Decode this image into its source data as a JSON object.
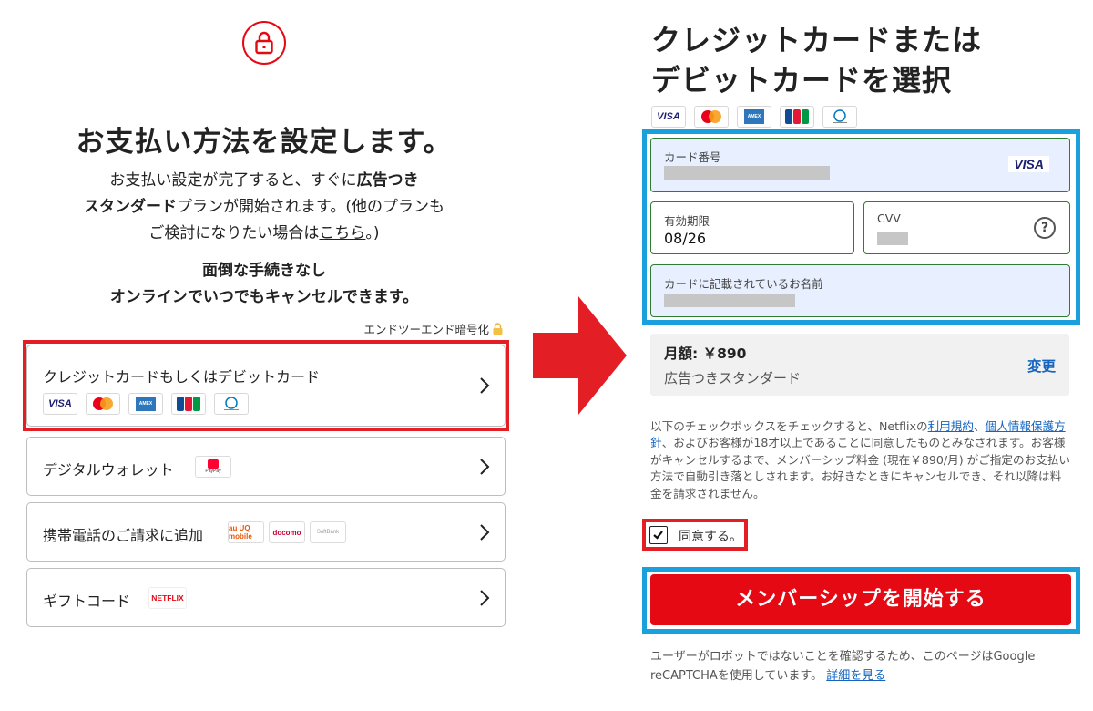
{
  "left": {
    "title": "お支払い方法を設定します。",
    "desc_line1": "お支払い設定が完了すると、すぐに",
    "desc_plan": "広告つき",
    "desc_line2_plan": "スタンダード",
    "desc_line2": "プランが開始されます。(他のプランも",
    "desc_line3": "ご検討になりたい場合は",
    "desc_link": "こちら",
    "desc_line3_end": "。)",
    "note_line1": "面倒な手続きなし",
    "note_line2": "オンラインでいつでもキャンセルできます。",
    "e2e_label": "エンドツーエンド暗号化",
    "options": [
      {
        "label": "クレジットカードもしくはデビットカード"
      },
      {
        "label": "デジタルウォレット",
        "logo": "PayPay"
      },
      {
        "label": "携帯電話のご請求に追加",
        "logos": [
          "au UQ mobile",
          "docomo",
          "SoftBank"
        ]
      },
      {
        "label": "ギフトコード",
        "logo": "NETFLIX"
      }
    ],
    "card_brands": [
      "VISA",
      "Mastercard",
      "AMEX",
      "JCB",
      "Diners Club"
    ]
  },
  "right": {
    "title_line1": "クレジットカードまたは",
    "title_line2": "デビットカードを選択",
    "card_brands": [
      "VISA",
      "Mastercard",
      "AMEX",
      "JCB",
      "Diners Club"
    ],
    "card_number_label": "カード番号",
    "card_brand_badge": "VISA",
    "expiry_label": "有効期限",
    "expiry_value": "08/26",
    "cvv_label": "CVV",
    "cvv_help": "?",
    "name_label": "カードに記載されているお名前",
    "plan_price": "月額: ￥890",
    "plan_name": "広告つきスタンダード",
    "plan_change": "変更",
    "terms_part1": "以下のチェックボックスをチェックすると、Netflixの",
    "terms_link1": "利用規約",
    "terms_sep": "、",
    "terms_link2": "個人情報保護方針",
    "terms_part2": "、およびお客様が18才以上であることに同意したものとみなされます。お客様がキャンセルするまで、メンバーシップ料金 (現在￥890/月) がご指定のお支払い方法で自動引き落としされます。お好きなときにキャンセルでき、それ以降は料金を請求されません。",
    "agree_label": "同意する。",
    "start_button": "メンバーシップを開始する",
    "captcha_text": "ユーザーがロボットではないことを確認するため、このページはGoogle reCAPTCHAを使用しています。",
    "captcha_link": "詳細を見る"
  },
  "colors": {
    "netflix_red": "#e50914",
    "highlight_red": "#e31e24",
    "highlight_blue": "#1aa0dc",
    "link_blue": "#1565c0",
    "field_border_green": "#2e7d32"
  }
}
